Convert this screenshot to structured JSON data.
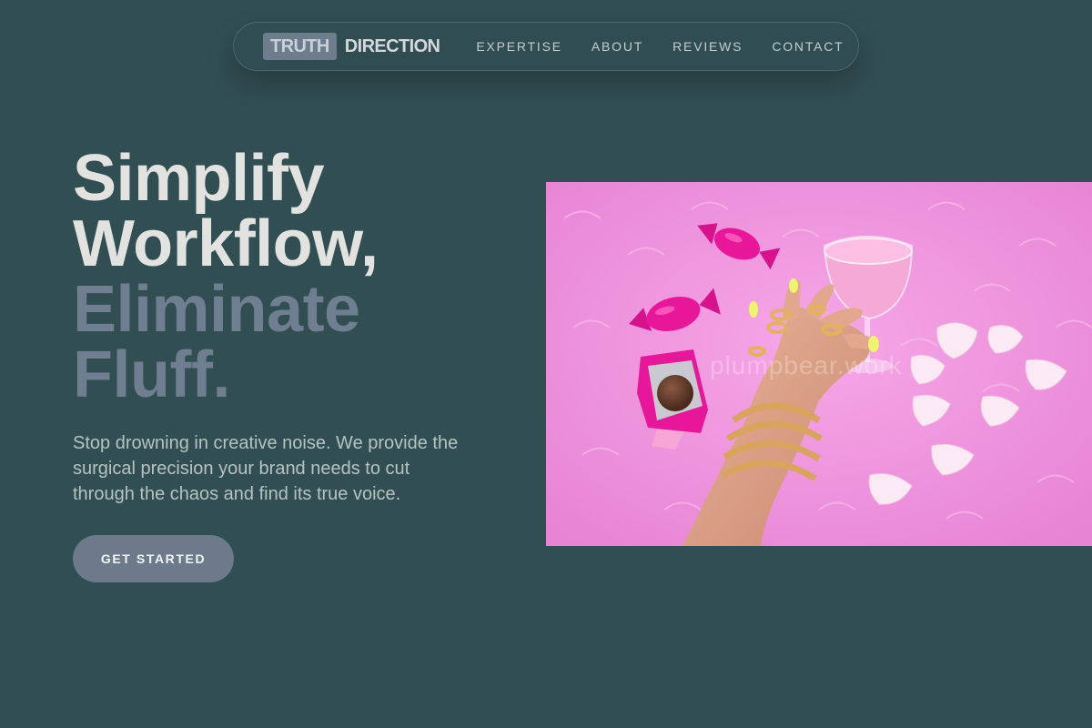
{
  "nav": {
    "logo_mark": "TRUTH",
    "logo_word": "DIRECTION",
    "links": [
      {
        "label": "EXPERTISE"
      },
      {
        "label": "ABOUT"
      },
      {
        "label": "REVIEWS"
      },
      {
        "label": "CONTACT"
      }
    ]
  },
  "hero": {
    "title_line1": "Simplify",
    "title_line2": "Workflow,",
    "title_line3": "Eliminate",
    "title_line4": "Fluff.",
    "subtitle": "Stop drowning in creative noise. We provide the surgical precision your brand needs to cut through the chaos and find its true voice.",
    "cta_label": "GET STARTED",
    "image_watermark": "plumpbear.work"
  },
  "colors": {
    "background": "#314e52",
    "accent": "#6c7a8c",
    "title_light": "#e2e3e1",
    "title_muted": "#6f7e90",
    "image_pink": "#ef95dc",
    "candy_magenta": "#e8179a"
  }
}
